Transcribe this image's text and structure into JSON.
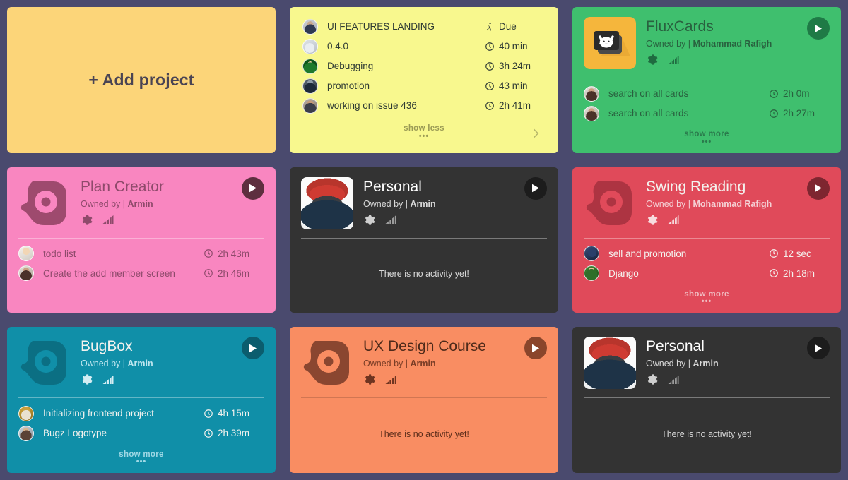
{
  "theme": {
    "page_background": "#4a4a6e"
  },
  "add_project": {
    "label": "+ Add project",
    "background": "#fcd579"
  },
  "cards": [
    {
      "id": "activity-list",
      "kind": "activity-list",
      "background": "#f8f88e",
      "rows": [
        {
          "name": "UI FEATURES LANDING",
          "time": "Due",
          "icon": "walk-icon",
          "avatar": "av-a"
        },
        {
          "name": "0.4.0",
          "time": "40 min",
          "icon": "clock-icon",
          "avatar": "av-b"
        },
        {
          "name": "Debugging",
          "time": "3h 24m",
          "icon": "clock-icon",
          "avatar": "av-c"
        },
        {
          "name": "promotion",
          "time": "43 min",
          "icon": "clock-icon",
          "avatar": "av-d"
        },
        {
          "name": "working on issue 436",
          "time": "2h 41m",
          "icon": "clock-icon",
          "avatar": "av-e"
        }
      ],
      "toggle_label": "show less",
      "toggle_dots": "•••",
      "next_icon": "chevron-right-icon"
    },
    {
      "id": "fluxcards",
      "kind": "project",
      "title": "FluxCards",
      "owned_by_label": "Owned by |",
      "owner": "Mohammad Rafigh",
      "background": "#3fbf6e",
      "logo": "fluxcards-logo",
      "rows": [
        {
          "name": "search on all cards",
          "time": "2h 0m",
          "avatar": "av-f"
        },
        {
          "name": "search on all cards",
          "time": "2h 27m",
          "avatar": "av-f"
        }
      ],
      "toggle_label": "show more",
      "toggle_dots": "•••"
    },
    {
      "id": "plan-creator",
      "kind": "project",
      "title": "Plan Creator",
      "owned_by_label": "Owned by |",
      "owner": "Armin",
      "background": "#f986c0",
      "logo": "paymo-p-logo",
      "rows": [
        {
          "name": "todo list",
          "time": "2h 43m",
          "avatar": "av-g"
        },
        {
          "name": "Create the add member screen",
          "time": "2h 46m",
          "avatar": "av-f"
        }
      ],
      "toggle_label": "",
      "toggle_dots": ""
    },
    {
      "id": "personal-1",
      "kind": "project",
      "title": "Personal",
      "owned_by_label": "Owned by |",
      "owner": "Armin",
      "background": "#333333",
      "logo": "photo-avatar",
      "rows": [],
      "empty_text": "There is no activity yet!"
    },
    {
      "id": "swing-reading",
      "kind": "project",
      "title": "Swing Reading",
      "owned_by_label": "Owned by |",
      "owner": "Mohammad Rafigh",
      "background": "#e04a5a",
      "logo": "paymo-p-logo",
      "rows": [
        {
          "name": "sell and promotion",
          "time": "12 sec",
          "avatar": "av-h"
        },
        {
          "name": "Django",
          "time": "2h 18m",
          "avatar": "av-i"
        }
      ],
      "toggle_label": "show more",
      "toggle_dots": "•••"
    },
    {
      "id": "bugbox",
      "kind": "project",
      "title": "BugBox",
      "owned_by_label": "Owned by |",
      "owner": "Armin",
      "background": "#108fa8",
      "logo": "paymo-p-logo",
      "rows": [
        {
          "name": "Initializing frontend project",
          "time": "4h 15m",
          "avatar": "av-j"
        },
        {
          "name": "Bugz Logotype",
          "time": "2h 39m",
          "avatar": "av-k"
        }
      ],
      "toggle_label": "show more",
      "toggle_dots": "•••"
    },
    {
      "id": "ux-design-course",
      "kind": "project",
      "title": "UX Design Course",
      "owned_by_label": "Owned by |",
      "owner": "Armin",
      "background": "#f98d62",
      "logo": "paymo-p-logo",
      "rows": [],
      "empty_text": "There is no activity yet!"
    },
    {
      "id": "personal-2",
      "kind": "project",
      "title": "Personal",
      "owned_by_label": "Owned by |",
      "owner": "Armin",
      "background": "#333333",
      "logo": "photo-avatar",
      "rows": [],
      "empty_text": "There is no activity yet!"
    }
  ],
  "icons": {
    "settings": "gear-icon",
    "stats": "bar-chart-icon",
    "play": "play-icon",
    "clock": "clock-icon",
    "walk": "walk-icon"
  }
}
